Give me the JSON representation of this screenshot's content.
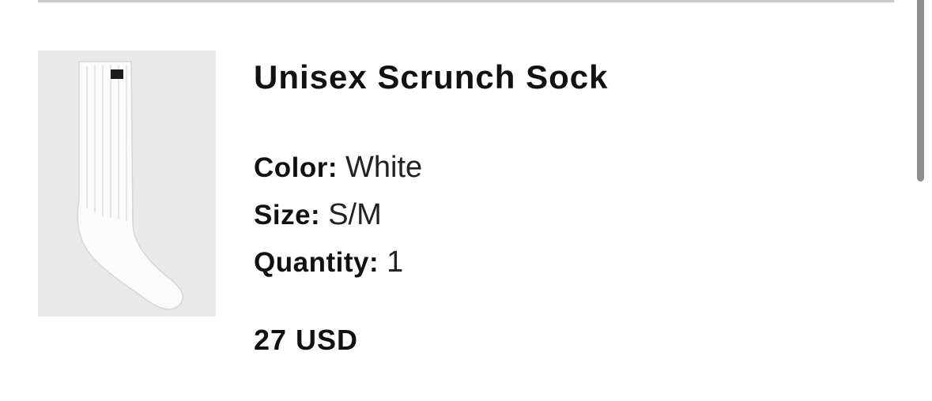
{
  "product": {
    "title": "Unisex Scrunch Sock",
    "image_alt": "White crew sock",
    "brand_tag": "alo",
    "attributes": [
      {
        "label": "Color:",
        "value": "White"
      },
      {
        "label": "Size:",
        "value": "S/M"
      },
      {
        "label": "Quantity:",
        "value": "1"
      }
    ],
    "price": "27 USD"
  },
  "colors": {
    "divider": "#c9c9c9",
    "scrollbar": "#8e8e8e",
    "thumbnail_bg": "#e9e9e9"
  }
}
